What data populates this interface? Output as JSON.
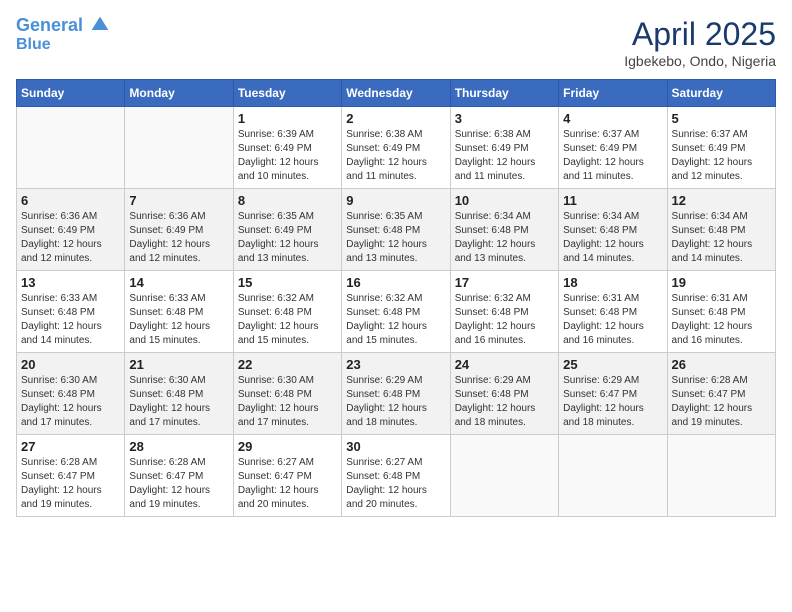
{
  "header": {
    "logo_line1": "General",
    "logo_line2": "Blue",
    "month_title": "April 2025",
    "location": "Igbekebo, Ondo, Nigeria"
  },
  "weekdays": [
    "Sunday",
    "Monday",
    "Tuesday",
    "Wednesday",
    "Thursday",
    "Friday",
    "Saturday"
  ],
  "weeks": [
    [
      {
        "day": "",
        "info": ""
      },
      {
        "day": "",
        "info": ""
      },
      {
        "day": "1",
        "info": "Sunrise: 6:39 AM\nSunset: 6:49 PM\nDaylight: 12 hours and 10 minutes."
      },
      {
        "day": "2",
        "info": "Sunrise: 6:38 AM\nSunset: 6:49 PM\nDaylight: 12 hours and 11 minutes."
      },
      {
        "day": "3",
        "info": "Sunrise: 6:38 AM\nSunset: 6:49 PM\nDaylight: 12 hours and 11 minutes."
      },
      {
        "day": "4",
        "info": "Sunrise: 6:37 AM\nSunset: 6:49 PM\nDaylight: 12 hours and 11 minutes."
      },
      {
        "day": "5",
        "info": "Sunrise: 6:37 AM\nSunset: 6:49 PM\nDaylight: 12 hours and 12 minutes."
      }
    ],
    [
      {
        "day": "6",
        "info": "Sunrise: 6:36 AM\nSunset: 6:49 PM\nDaylight: 12 hours and 12 minutes."
      },
      {
        "day": "7",
        "info": "Sunrise: 6:36 AM\nSunset: 6:49 PM\nDaylight: 12 hours and 12 minutes."
      },
      {
        "day": "8",
        "info": "Sunrise: 6:35 AM\nSunset: 6:49 PM\nDaylight: 12 hours and 13 minutes."
      },
      {
        "day": "9",
        "info": "Sunrise: 6:35 AM\nSunset: 6:48 PM\nDaylight: 12 hours and 13 minutes."
      },
      {
        "day": "10",
        "info": "Sunrise: 6:34 AM\nSunset: 6:48 PM\nDaylight: 12 hours and 13 minutes."
      },
      {
        "day": "11",
        "info": "Sunrise: 6:34 AM\nSunset: 6:48 PM\nDaylight: 12 hours and 14 minutes."
      },
      {
        "day": "12",
        "info": "Sunrise: 6:34 AM\nSunset: 6:48 PM\nDaylight: 12 hours and 14 minutes."
      }
    ],
    [
      {
        "day": "13",
        "info": "Sunrise: 6:33 AM\nSunset: 6:48 PM\nDaylight: 12 hours and 14 minutes."
      },
      {
        "day": "14",
        "info": "Sunrise: 6:33 AM\nSunset: 6:48 PM\nDaylight: 12 hours and 15 minutes."
      },
      {
        "day": "15",
        "info": "Sunrise: 6:32 AM\nSunset: 6:48 PM\nDaylight: 12 hours and 15 minutes."
      },
      {
        "day": "16",
        "info": "Sunrise: 6:32 AM\nSunset: 6:48 PM\nDaylight: 12 hours and 15 minutes."
      },
      {
        "day": "17",
        "info": "Sunrise: 6:32 AM\nSunset: 6:48 PM\nDaylight: 12 hours and 16 minutes."
      },
      {
        "day": "18",
        "info": "Sunrise: 6:31 AM\nSunset: 6:48 PM\nDaylight: 12 hours and 16 minutes."
      },
      {
        "day": "19",
        "info": "Sunrise: 6:31 AM\nSunset: 6:48 PM\nDaylight: 12 hours and 16 minutes."
      }
    ],
    [
      {
        "day": "20",
        "info": "Sunrise: 6:30 AM\nSunset: 6:48 PM\nDaylight: 12 hours and 17 minutes."
      },
      {
        "day": "21",
        "info": "Sunrise: 6:30 AM\nSunset: 6:48 PM\nDaylight: 12 hours and 17 minutes."
      },
      {
        "day": "22",
        "info": "Sunrise: 6:30 AM\nSunset: 6:48 PM\nDaylight: 12 hours and 17 minutes."
      },
      {
        "day": "23",
        "info": "Sunrise: 6:29 AM\nSunset: 6:48 PM\nDaylight: 12 hours and 18 minutes."
      },
      {
        "day": "24",
        "info": "Sunrise: 6:29 AM\nSunset: 6:48 PM\nDaylight: 12 hours and 18 minutes."
      },
      {
        "day": "25",
        "info": "Sunrise: 6:29 AM\nSunset: 6:47 PM\nDaylight: 12 hours and 18 minutes."
      },
      {
        "day": "26",
        "info": "Sunrise: 6:28 AM\nSunset: 6:47 PM\nDaylight: 12 hours and 19 minutes."
      }
    ],
    [
      {
        "day": "27",
        "info": "Sunrise: 6:28 AM\nSunset: 6:47 PM\nDaylight: 12 hours and 19 minutes."
      },
      {
        "day": "28",
        "info": "Sunrise: 6:28 AM\nSunset: 6:47 PM\nDaylight: 12 hours and 19 minutes."
      },
      {
        "day": "29",
        "info": "Sunrise: 6:27 AM\nSunset: 6:47 PM\nDaylight: 12 hours and 20 minutes."
      },
      {
        "day": "30",
        "info": "Sunrise: 6:27 AM\nSunset: 6:48 PM\nDaylight: 12 hours and 20 minutes."
      },
      {
        "day": "",
        "info": ""
      },
      {
        "day": "",
        "info": ""
      },
      {
        "day": "",
        "info": ""
      }
    ]
  ]
}
